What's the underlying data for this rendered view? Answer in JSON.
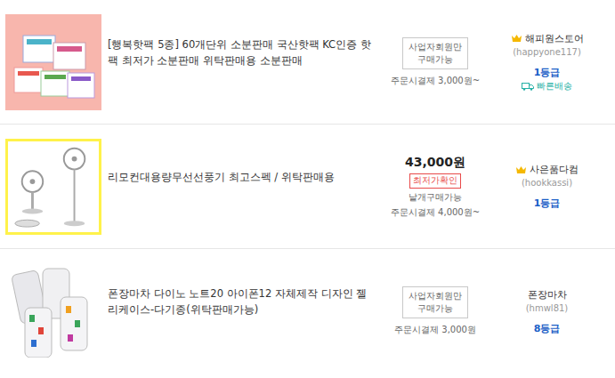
{
  "products": [
    {
      "image": "hotpack",
      "highlighted": false,
      "title": "[행복핫팩 5종] 60개단위 소분판매 국산핫팩 KC인증 핫팩 최저가 소분판매 위탁판매용 소분판매",
      "business_only": [
        "사업자회원만",
        "구매가능"
      ],
      "notes": [
        "주문시결제 3,000원~"
      ],
      "seller": {
        "name": "해피원스토어",
        "id": "(happyone117)",
        "grade": "1등급",
        "crown": true,
        "fast_delivery": "빠른배송"
      }
    },
    {
      "image": "fan",
      "highlighted": true,
      "title": "리모컨대용량무선선풍기 최고스펙 / 위탁판매용",
      "price": "43,000원",
      "price_tag": "최저가확인",
      "notes": [
        "낱개구매가능",
        "주문시결제 4,000원~"
      ],
      "seller": {
        "name": "사은품다컴",
        "id": "(hookkassi)",
        "grade": "1등급",
        "crown": true
      }
    },
    {
      "image": "phonecase",
      "highlighted": false,
      "title": "폰장마차 다이노 노트20 아이폰12 자체제작 디자인 젤리케이스-다기종(위탁판매가능)",
      "business_only": [
        "사업자회원만",
        "구매가능"
      ],
      "notes": [
        "주문시결제 3,000원"
      ],
      "seller": {
        "name": "폰장마차",
        "id": "(hmwl81)",
        "grade": "8등급",
        "crown": false
      }
    }
  ]
}
